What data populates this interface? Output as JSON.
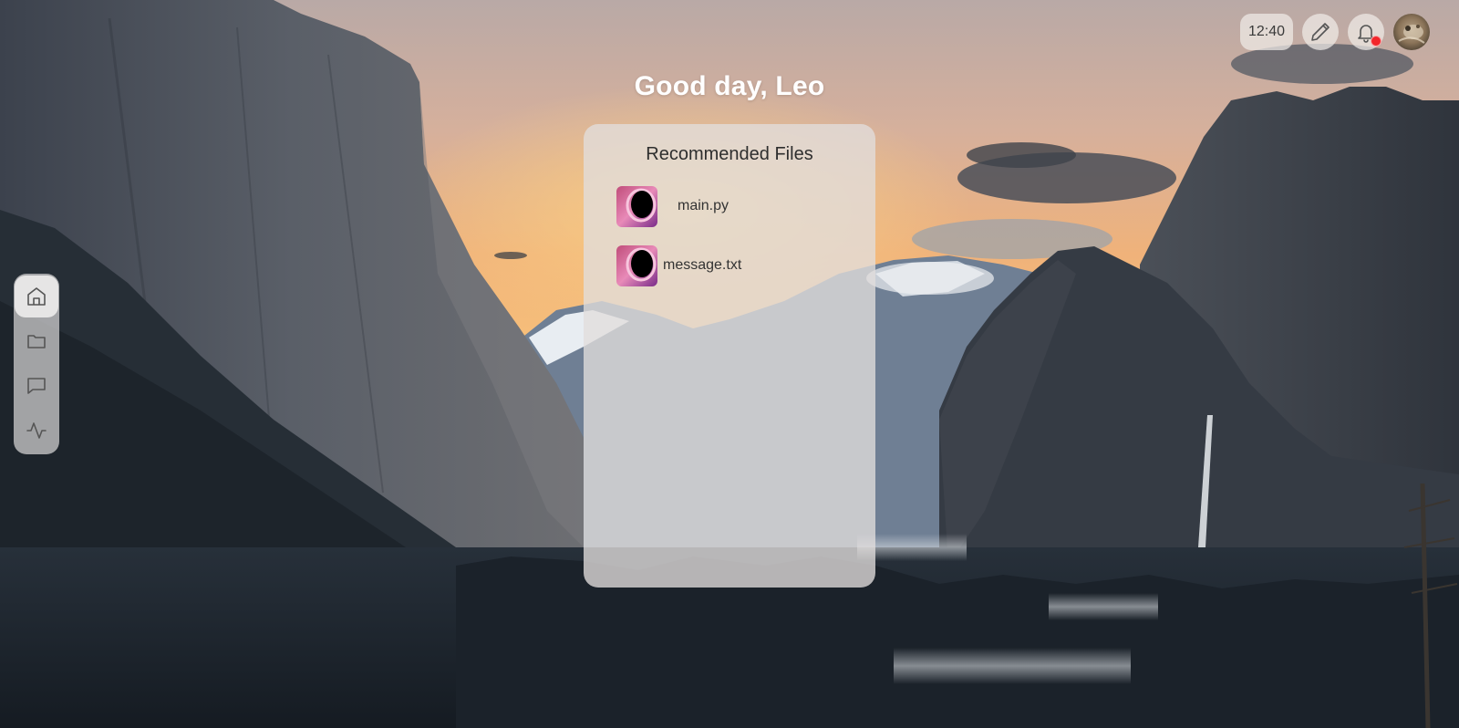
{
  "header": {
    "clock": "12:40",
    "edit_icon": "pencil-icon",
    "notification_icon": "bell-icon",
    "notification_badge_color": "#f2262a",
    "avatar_icon": "user-avatar"
  },
  "greeting": "Good day, Leo",
  "recommended": {
    "title": "Recommended Files",
    "files": [
      {
        "name": "main.py",
        "icon": "file-thumbnail-icon"
      },
      {
        "name": "message.txt",
        "icon": "file-thumbnail-icon"
      }
    ]
  },
  "dock": {
    "items": [
      {
        "icon": "home-icon",
        "active": true
      },
      {
        "icon": "folder-icon",
        "active": false
      },
      {
        "icon": "chat-icon",
        "active": false
      },
      {
        "icon": "activity-icon",
        "active": false
      }
    ]
  },
  "colors": {
    "panel_text": "#2e2e2e",
    "greeting_text": "#ffffff",
    "icon_stroke": "#555555"
  }
}
